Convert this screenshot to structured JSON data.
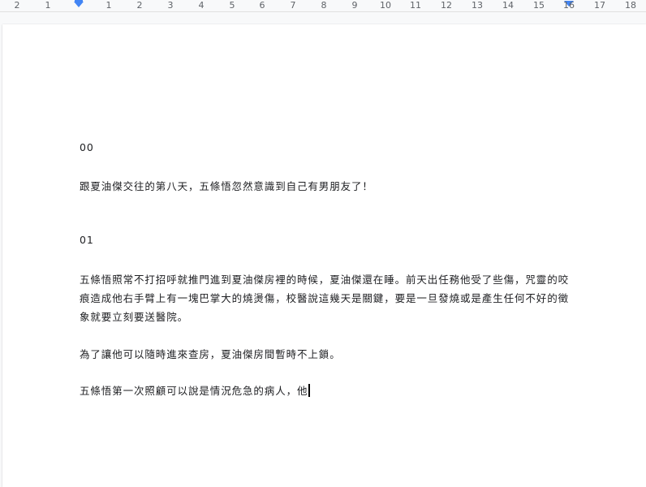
{
  "ruler": {
    "labels": [
      "2",
      "1",
      "1",
      "2",
      "3",
      "4",
      "5",
      "6",
      "7",
      "8",
      "9",
      "10",
      "11",
      "12",
      "13",
      "14",
      "15",
      "16",
      "17",
      "18"
    ]
  },
  "document": {
    "heading_00": "00",
    "line_1": "跟夏油傑交往的第八天，五條悟忽然意識到自己有男朋友了！",
    "heading_01": "01",
    "para_1_line_1": "五條悟照常不打招呼就推門進到夏油傑房裡的時候，夏油傑還在睡。前天出任務他受了些傷，咒靈的咬",
    "para_1_line_2": "痕造成他右手臂上有一塊巴掌大的燒燙傷，校醫說這幾天是關鍵，要是一旦發燒或是產生任何不好的徵",
    "para_1_line_3": "象就要立刻要送醫院。",
    "para_2": "為了讓他可以隨時進來查房，夏油傑房間暫時不上鎖。",
    "para_3": "五條悟第一次照顧可以說是情況危急的病人，他"
  }
}
